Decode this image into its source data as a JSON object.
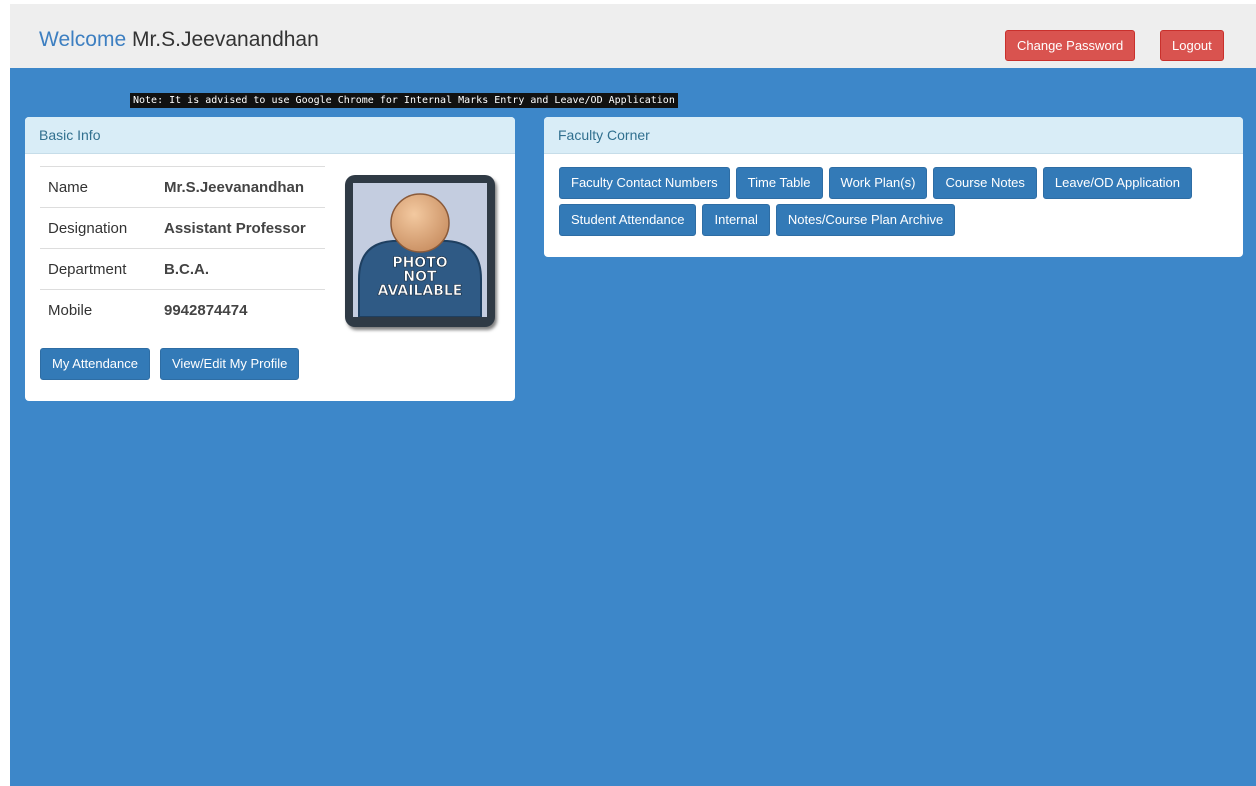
{
  "header": {
    "welcome_word": "Welcome",
    "user_name": "Mr.S.Jeevanandhan",
    "change_password_label": "Change Password",
    "logout_label": "Logout"
  },
  "note": "Note: It is advised to use Google Chrome for Internal Marks Entry and Leave/OD Application",
  "basic_info": {
    "title": "Basic Info",
    "rows": [
      {
        "label": "Name",
        "value": "Mr.S.Jeevanandhan"
      },
      {
        "label": "Designation",
        "value": "Assistant Professor"
      },
      {
        "label": "Department",
        "value": "B.C.A."
      },
      {
        "label": "Mobile",
        "value": "9942874474"
      }
    ],
    "photo_text": [
      "PHOTO",
      "NOT",
      "AVAILABLE"
    ],
    "buttons": [
      "My Attendance",
      "View/Edit My Profile"
    ]
  },
  "faculty_corner": {
    "title": "Faculty Corner",
    "row1": [
      "Faculty Contact Numbers",
      "Time Table",
      "Work Plan(s)",
      "Course Notes",
      "Leave/OD Application"
    ],
    "row2": [
      "Student Attendance",
      "Internal",
      "Notes/Course Plan Archive"
    ]
  },
  "colors": {
    "background_blue": "#3d87c9",
    "primary_button": "#337ab7",
    "danger_button": "#d9534f",
    "panel_heading": "#d9edf7"
  },
  "icons": [
    "avatar-placeholder-icon"
  ]
}
